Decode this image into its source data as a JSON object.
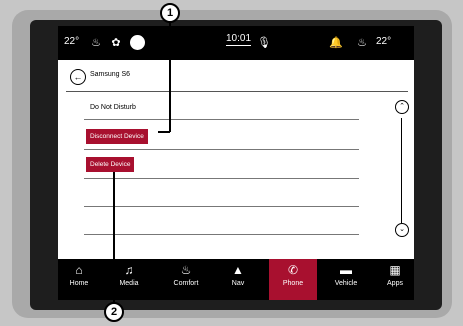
{
  "status": {
    "left_temp": "22°",
    "time": "10:01",
    "right_temp": "22°"
  },
  "header": {
    "title": "Samsung S6"
  },
  "list": {
    "do_not_disturb": "Do Not Disturb",
    "disconnect": "Disconnect Device",
    "delete": "Delete Device"
  },
  "nav": {
    "items": [
      {
        "label": "Home",
        "icon": "home-icon"
      },
      {
        "label": "Media",
        "icon": "music-icon"
      },
      {
        "label": "Comfort",
        "icon": "seat-icon"
      },
      {
        "label": "Nav",
        "icon": "navigation-arrow-icon"
      },
      {
        "label": "Phone",
        "icon": "phone-icon",
        "active": true
      },
      {
        "label": "Vehicle",
        "icon": "car-icon"
      },
      {
        "label": "Apps",
        "icon": "grid-icon"
      }
    ]
  },
  "callouts": [
    "1",
    "2"
  ],
  "colors": {
    "accent": "#a8102f",
    "bar": "#000000"
  }
}
